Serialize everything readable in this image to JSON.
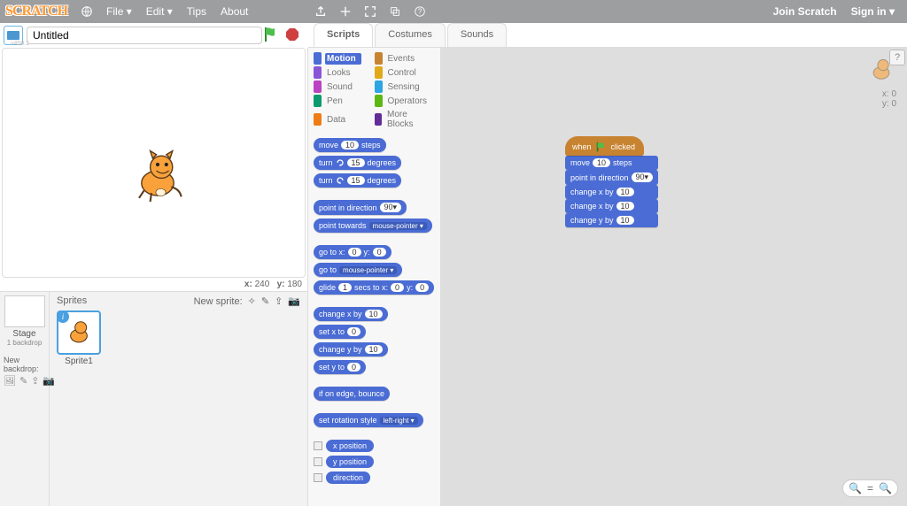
{
  "topbar": {
    "logo": "SCRATCH",
    "menu": {
      "file": "File ▾",
      "edit": "Edit ▾",
      "tips": "Tips",
      "about": "About"
    },
    "right": {
      "join": "Join Scratch",
      "signin": "Sign in ▾"
    }
  },
  "version_tag": "v458.1",
  "project": {
    "title_value": "Untitled"
  },
  "stage": {
    "coord_label_x": "x:",
    "coord_x": "240",
    "coord_label_y": "y:",
    "coord_y": "180"
  },
  "sprite_pane": {
    "sprites_label": "Sprites",
    "new_sprite_label": "New sprite:",
    "stage_label": "Stage",
    "backdrop_count": "1 backdrop",
    "new_backdrop_label": "New backdrop:",
    "sprite1_name": "Sprite1"
  },
  "tabs": {
    "scripts": "Scripts",
    "costumes": "Costumes",
    "sounds": "Sounds"
  },
  "categories": [
    {
      "name": "Motion",
      "color": "#4a6cd4",
      "selected": true
    },
    {
      "name": "Events",
      "color": "#c88330"
    },
    {
      "name": "Looks",
      "color": "#8a55d7"
    },
    {
      "name": "Control",
      "color": "#e1a91a"
    },
    {
      "name": "Sound",
      "color": "#bb42c3"
    },
    {
      "name": "Sensing",
      "color": "#2ca5e2"
    },
    {
      "name": "Pen",
      "color": "#0e9a6c"
    },
    {
      "name": "Operators",
      "color": "#5cb712"
    },
    {
      "name": "Data",
      "color": "#ee7d16"
    },
    {
      "name": "More Blocks",
      "color": "#632d99"
    }
  ],
  "palette": {
    "move": {
      "pre": "move",
      "val": "10",
      "post": "steps"
    },
    "turn_cw": {
      "pre": "turn",
      "val": "15",
      "post": "degrees"
    },
    "turn_ccw": {
      "pre": "turn",
      "val": "15",
      "post": "degrees"
    },
    "point_dir": {
      "pre": "point in direction",
      "val": "90▾"
    },
    "point_towards": {
      "pre": "point towards",
      "val": "mouse-pointer ▾"
    },
    "gotoxy": {
      "pre": "go to x:",
      "v1": "0",
      "mid": "y:",
      "v2": "0"
    },
    "goto": {
      "pre": "go to",
      "val": "mouse-pointer ▾"
    },
    "glide": {
      "pre": "glide",
      "v1": "1",
      "mid": "secs to x:",
      "v2": "0",
      "mid2": "y:",
      "v3": "0"
    },
    "changex": {
      "pre": "change x by",
      "val": "10"
    },
    "setx": {
      "pre": "set x to",
      "val": "0"
    },
    "changey": {
      "pre": "change y by",
      "val": "10"
    },
    "sety": {
      "pre": "set y to",
      "val": "0"
    },
    "bounce": {
      "txt": "if on edge, bounce"
    },
    "rotstyle": {
      "pre": "set rotation style",
      "val": "left-right ▾"
    },
    "xpos": "x position",
    "ypos": "y position",
    "dir": "direction"
  },
  "script_area": {
    "xy": {
      "xlabel": "x:",
      "x": "0",
      "ylabel": "y:",
      "y": "0"
    },
    "stack": {
      "hat": {
        "pre": "when",
        "post": "clicked"
      },
      "b1": {
        "pre": "move",
        "val": "10",
        "post": "steps"
      },
      "b2": {
        "pre": "point in direction",
        "val": "90▾"
      },
      "b3": {
        "pre": "change x by",
        "val": "10"
      },
      "b4": {
        "pre": "change x by",
        "val": "10"
      },
      "b5": {
        "pre": "change y by",
        "val": "10"
      }
    }
  }
}
